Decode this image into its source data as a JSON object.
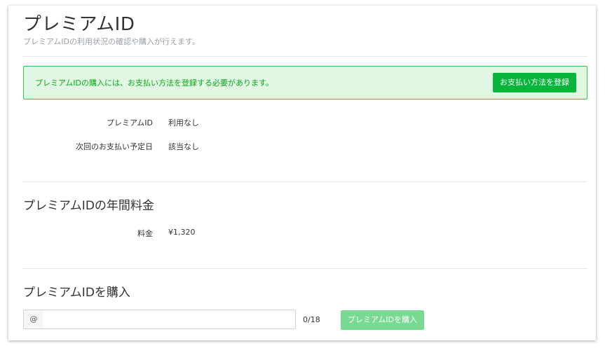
{
  "header": {
    "title": "プレミアムID",
    "subtitle": "プレミアムIDの利用状況の確認や購入が行えます。"
  },
  "notice": {
    "text": "プレミアムIDの購入には、お支払い方法を登録する必要があります。",
    "button_label": "お支払い方法を登録"
  },
  "status": {
    "rows": [
      {
        "label": "プレミアムID",
        "value": "利用なし"
      },
      {
        "label": "次回のお支払い予定日",
        "value": "該当なし"
      }
    ]
  },
  "annual_fee": {
    "title": "プレミアムIDの年間料金",
    "label": "料金",
    "value": "¥1,320"
  },
  "purchase": {
    "title": "プレミアムIDを購入",
    "at_symbol": "@",
    "input_value": "",
    "counter": "0/18",
    "button_label": "プレミアムIDを購入"
  },
  "colors": {
    "accent_green": "#07b53b",
    "notice_bg": "#e1f6e3",
    "notice_text": "#06a719",
    "disabled_green": "#79d891"
  }
}
